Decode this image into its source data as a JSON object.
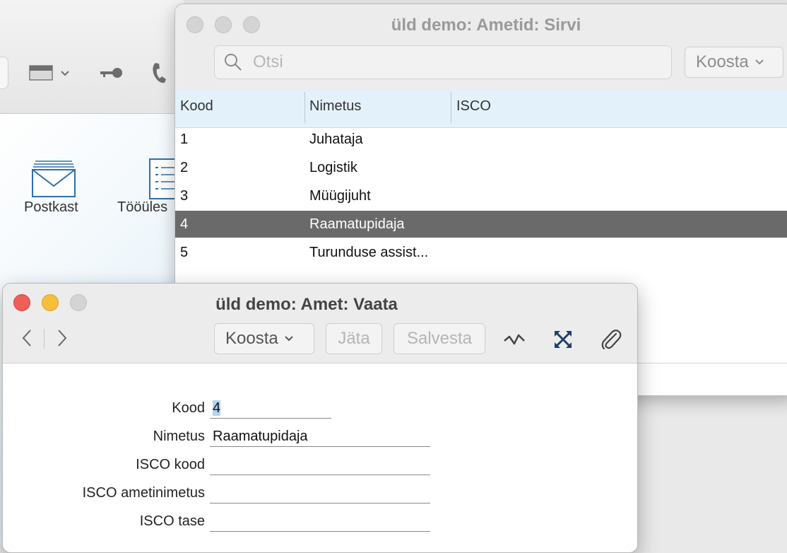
{
  "background_window": {
    "desk_icons": [
      {
        "label": "Postkast",
        "icon": "mailbox-icon"
      },
      {
        "label": "Tööüles",
        "icon": "task-list-icon"
      }
    ]
  },
  "browse_window": {
    "title": "üld demo: Ametid: Sirvi",
    "search": {
      "placeholder": "Otsi",
      "value": ""
    },
    "koosta_label": "Koosta",
    "columns": [
      "Kood",
      "Nimetus",
      "ISCO"
    ],
    "rows": [
      {
        "kood": "1",
        "nimetus": "Juhataja",
        "isco": ""
      },
      {
        "kood": "2",
        "nimetus": "Logistik",
        "isco": ""
      },
      {
        "kood": "3",
        "nimetus": "Müügijuht",
        "isco": ""
      },
      {
        "kood": "4",
        "nimetus": "Raamatupidaja",
        "isco": "",
        "selected": true
      },
      {
        "kood": "5",
        "nimetus": "Turunduse assist...",
        "isco": ""
      }
    ]
  },
  "record_window": {
    "title": "üld demo: Amet: Vaata",
    "toolbar": {
      "koosta_label": "Koosta",
      "jata_label": "Jäta",
      "salvesta_label": "Salvesta"
    },
    "fields": {
      "kood": {
        "label": "Kood",
        "value": "4"
      },
      "nimetus": {
        "label": "Nimetus",
        "value": "Raamatupidaja"
      },
      "isco_kood": {
        "label": "ISCO kood",
        "value": ""
      },
      "isco_ametinimetus": {
        "label": "ISCO ametinimetus",
        "value": ""
      },
      "isco_tase": {
        "label": "ISCO tase",
        "value": ""
      }
    }
  },
  "colors": {
    "selected_row": "#6a6a6a",
    "header_bg": "#e3f1fb",
    "close_red": "#ee5f57",
    "minimize_yellow": "#f6be3a",
    "selection_highlight": "#b3d2f5"
  }
}
